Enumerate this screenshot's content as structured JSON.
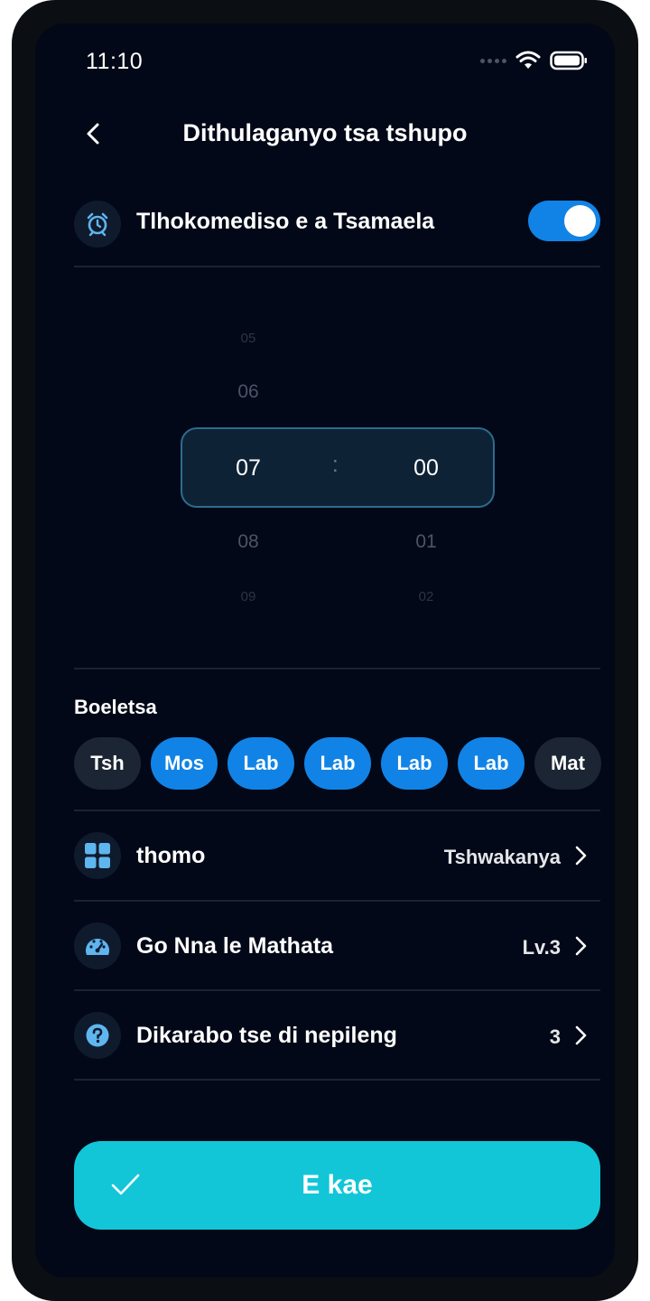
{
  "status_bar": {
    "time": "11:10"
  },
  "header": {
    "title": "Dithulaganyo tsa tshupo"
  },
  "reminder": {
    "label": "Tlhokomediso e a Tsamaela",
    "enabled": true,
    "icon": "alarm-clock-icon"
  },
  "time_picker": {
    "hours": [
      "05",
      "06",
      "07",
      "08",
      "09"
    ],
    "minutes": [
      "00",
      "01",
      "02"
    ],
    "selected_hour": "07",
    "selected_minute": "00",
    "separator": ":"
  },
  "repeat": {
    "label": "Boeletsa",
    "days": [
      {
        "label": "Tsh",
        "active": false
      },
      {
        "label": "Mos",
        "active": true
      },
      {
        "label": "Lab",
        "active": true
      },
      {
        "label": "Lab",
        "active": true
      },
      {
        "label": "Lab",
        "active": true
      },
      {
        "label": "Lab",
        "active": true
      },
      {
        "label": "Mat",
        "active": false
      }
    ]
  },
  "settings": [
    {
      "label": "thomo",
      "value": "Tshwakanya",
      "icon": "grid-icon"
    },
    {
      "label": "Go Nna le Mathata",
      "value": "Lv.3",
      "icon": "speedometer-icon"
    },
    {
      "label": "Dikarabo tse di nepileng",
      "value": "3",
      "icon": "question-icon"
    }
  ],
  "save_button": {
    "label": "E kae",
    "icon": "check-icon"
  },
  "colors": {
    "accent": "#1183e6",
    "save": "#12c6d8",
    "background": "#020817"
  }
}
